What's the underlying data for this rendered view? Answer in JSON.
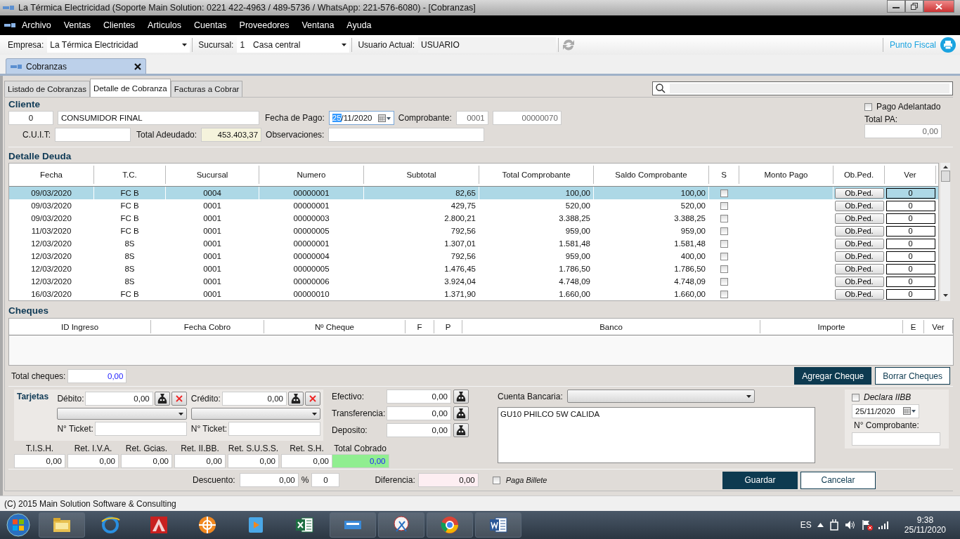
{
  "window": {
    "title": "La Térmica Electricidad (Soporte Main Solution: 0221 422-4963 / 489-5736 / WhatsApp: 221-576-6080) - [Cobranzas]"
  },
  "menu": [
    "Archivo",
    "Ventas",
    "Clientes",
    "Articulos",
    "Cuentas",
    "Proveedores",
    "Ventana",
    "Ayuda"
  ],
  "toolbar": {
    "empresa_label": "Empresa:",
    "empresa": "La Térmica Electricidad",
    "sucursal_label": "Sucursal:",
    "sucursal_num": "1",
    "sucursal": "Casa central",
    "usuario_label": "Usuario Actual:",
    "usuario": "USUARIO",
    "punto_fiscal": "Punto Fiscal"
  },
  "document_tab": {
    "label": "Cobranzas"
  },
  "tabs": [
    {
      "label": "Listado de Cobranzas",
      "selected": false
    },
    {
      "label": "Detalle de Cobranza",
      "selected": true
    },
    {
      "label": "Facturas a Cobrar",
      "selected": false
    }
  ],
  "cliente": {
    "title": "Cliente",
    "code": "0",
    "name": "CONSUMIDOR FINAL",
    "fecha_label": "Fecha de Pago:",
    "fecha_day": "25",
    "fecha_rest": "/11/2020",
    "comprobante_label": "Comprobante:",
    "punto_venta": "0001",
    "numero": "00000070",
    "cuit_label": "C.U.I.T:",
    "total_label": "Total Adeudado:",
    "total": "453.403,37",
    "obs_label": "Observaciones:",
    "pago_adelantado": {
      "label": "Pago Adelantado",
      "checked": false
    },
    "total_pa_label": "Total PA:",
    "total_pa": "0,00"
  },
  "deuda": {
    "title": "Detalle Deuda",
    "columns": [
      "Fecha",
      "T.C.",
      "Sucursal",
      "Numero",
      "Subtotal",
      "Total Comprobante",
      "Saldo Comprobante",
      "S",
      "Monto Pago",
      "Ob.Ped.",
      "Ver"
    ],
    "rows": [
      {
        "selected": true,
        "cells": [
          "09/03/2020",
          "FC B",
          "0004",
          "00000001",
          "82,65",
          "100,00",
          "100,00"
        ],
        "s": false,
        "monto": "",
        "obped": "Ob.Ped.",
        "ver": "0"
      },
      {
        "selected": false,
        "cells": [
          "09/03/2020",
          "FC B",
          "0001",
          "00000001",
          "429,75",
          "520,00",
          "520,00"
        ],
        "s": false,
        "monto": "",
        "obped": "Ob.Ped.",
        "ver": "0"
      },
      {
        "selected": false,
        "cells": [
          "09/03/2020",
          "FC B",
          "0001",
          "00000003",
          "2.800,21",
          "3.388,25",
          "3.388,25"
        ],
        "s": false,
        "monto": "",
        "obped": "Ob.Ped.",
        "ver": "0"
      },
      {
        "selected": false,
        "cells": [
          "11/03/2020",
          "FC B",
          "0001",
          "00000005",
          "792,56",
          "959,00",
          "959,00"
        ],
        "s": false,
        "monto": "",
        "obped": "Ob.Ped.",
        "ver": "0"
      },
      {
        "selected": false,
        "cells": [
          "12/03/2020",
          "8S",
          "0001",
          "00000001",
          "1.307,01",
          "1.581,48",
          "1.581,48"
        ],
        "s": false,
        "monto": "",
        "obped": "Ob.Ped.",
        "ver": "0"
      },
      {
        "selected": false,
        "cells": [
          "12/03/2020",
          "8S",
          "0001",
          "00000004",
          "792,56",
          "959,00",
          "400,00"
        ],
        "s": false,
        "monto": "",
        "obped": "Ob.Ped.",
        "ver": "0"
      },
      {
        "selected": false,
        "cells": [
          "12/03/2020",
          "8S",
          "0001",
          "00000005",
          "1.476,45",
          "1.786,50",
          "1.786,50"
        ],
        "s": false,
        "monto": "",
        "obped": "Ob.Ped.",
        "ver": "0"
      },
      {
        "selected": false,
        "cells": [
          "12/03/2020",
          "8S",
          "0001",
          "00000006",
          "3.924,04",
          "4.748,09",
          "4.748,09"
        ],
        "s": false,
        "monto": "",
        "obped": "Ob.Ped.",
        "ver": "0"
      },
      {
        "selected": false,
        "cells": [
          "16/03/2020",
          "FC B",
          "0001",
          "00000010",
          "1.371,90",
          "1.660,00",
          "1.660,00"
        ],
        "s": false,
        "monto": "",
        "obped": "Ob.Ped.",
        "ver": "0"
      }
    ]
  },
  "cheques": {
    "title": "Cheques",
    "columns": [
      "ID Ingreso",
      "Fecha Cobro",
      "Nº Cheque",
      "F",
      "P",
      "Banco",
      "Importe",
      "E",
      "Ver"
    ],
    "total_label": "Total cheques:",
    "total": "0,00",
    "add_button": "Agregar Cheque",
    "delete_button": "Borrar Cheques"
  },
  "tarjetas": {
    "title": "Tarjetas",
    "debito_label": "Débito:",
    "debito": "0,00",
    "credito_label": "Crédito:",
    "credito": "0,00",
    "ticket_label_1": "N° Ticket:",
    "ticket_label_2": "N° Ticket:"
  },
  "pagos": [
    {
      "label": "Efectivo:",
      "value": "0,00"
    },
    {
      "label": "Transferencia:",
      "value": "0,00"
    },
    {
      "label": "Deposito:",
      "value": "0,00"
    }
  ],
  "retenciones": [
    {
      "label": "T.I.S.H.",
      "value": "0,00"
    },
    {
      "label": "Ret. I.V.A.",
      "value": "0,00"
    },
    {
      "label": "Ret. Gcias.",
      "value": "0,00"
    },
    {
      "label": "Ret. II.BB.",
      "value": "0,00"
    },
    {
      "label": "Ret. S.U.S.S.",
      "value": "0,00"
    },
    {
      "label": "Ret. S.H.",
      "value": "0,00"
    },
    {
      "label": "Total Cobrado",
      "value": "0,00",
      "kind": "total"
    }
  ],
  "cuenta": {
    "label": "Cuenta Bancaria:",
    "notes": "GU10 PHILCO 5W CALIDA"
  },
  "iibb": {
    "label": "Declara IIBB",
    "checked": false,
    "date": "25/11/2020",
    "comprobante_label": "N° Comprobante:"
  },
  "footer": {
    "descuento_label": "Descuento:",
    "descuento": "0,00",
    "percent_label": "%",
    "percent": "0",
    "diferencia_label": "Diferencia:",
    "diferencia": "0,00",
    "paga_billete": {
      "label": "Paga Billete",
      "checked": false
    },
    "save_button": "Guardar",
    "cancel_button": "Cancelar"
  },
  "status_bar": "(C) 2015 Main Solution Software & Consulting",
  "taskbar": {
    "language": "ES",
    "time": "9:38",
    "date": "25/11/2020"
  }
}
